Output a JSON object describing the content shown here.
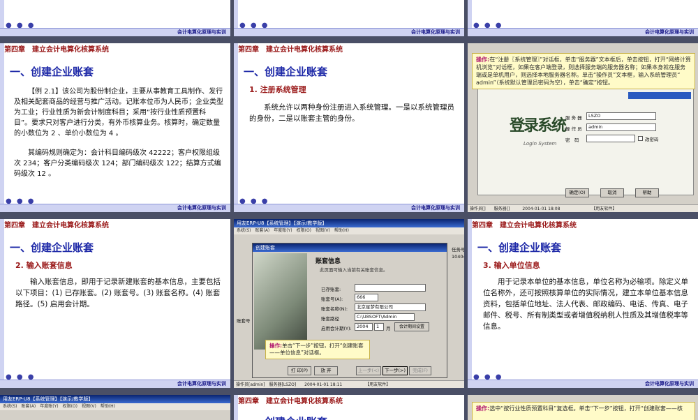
{
  "common": {
    "brand": "会计电算化原理与实训",
    "dots": "● ● ●",
    "chapter": "第四章　建立会计电算化核算系统"
  },
  "s4": {
    "title": "一、创建企业账套",
    "p1": "【例 2.1】该公司为股份制企业，主要从事教育工具制作、发行及相关配套商品的经营与推广活动。记账本位币为人民币；企业类型为工业；行业性质为新会计制度科目；采用“按行业性质预置科目”。要求只对客户进行分类，有外币核算业务。核算时，确定数量的小数位为 2 、单价小数位为 4 。",
    "p2": "其编码规则确定为：会计科目编码级次 42222；客户权限组级次 234；客户分类编码级次 124；部门编码级次 122；结算方式编码级次 12 。"
  },
  "s5": {
    "title": "一、创建企业账套",
    "subtitle": "1. 注册系统管理",
    "p1": "系统允许以两种身份注册进入系统管理。一是以系统管理员的身份，二是以账套主管的身份。"
  },
  "s6": {
    "note_key": "操作:",
    "note": "在“注册〖系统管理〗”对话框，单击“服务器”文本框后，单击按钮，打开“网络计算机浏览”对话框，如果在客户端登录，则选择服务端的服务器名称；如果本身就在服务端或是单机用户，则选择本地服务器名称。单击“操作员”文本框，输入系统管理员“ admin”（系统默认管理员密码为空），单击“确定”按钮。",
    "logo": "登录系统",
    "logo_sub": "Login System",
    "server_label": "服 务 器",
    "server_value": "LSZO",
    "operator_label": "操 作 员",
    "operator_value": "admin",
    "password_label": "密　码",
    "change_pwd": "改密码",
    "ok": "确定(O)",
    "cancel": "取消",
    "help": "帮助",
    "status": "操作员[]　　服务器[]　　　2004-01-01 18:08　　　　　　　　【用友软件】"
  },
  "s7": {
    "title": "一、创建企业账套",
    "subtitle": "2. 输入账套信息",
    "p1": "输入账套信息，即用于记录新建账套的基本信息，主要包括以下项目：(1) 已存账套。(2) 账套号。(3) 账套名称。(4) 账套路径。(5) 启用会计期。"
  },
  "s8": {
    "window_title": "用友ERP-U8【系统管理】【演示/教学版】",
    "menu": "系统(S)　账套(A)　年度账(Y)　权限(O)　视图(V)　帮助(H)",
    "dialog_title": "创建账套",
    "header": "账套信息",
    "header_sub": "此页面可输入当前有关账套信息。",
    "existing_label": "已存账套:",
    "acct_no_label": "账套号(A):",
    "acct_no": "666",
    "acct_name_label": "账套名称(N):",
    "acct_name": "北京星梦有限公司",
    "path_label": "账套路径",
    "path": "C:\\U8SOFT\\Admin",
    "period_label": "启用会计期(Y):",
    "year": "2004",
    "month": "1",
    "month_suffix": "月",
    "period_btn": "会计期间设置",
    "task_label": "任务号",
    "task_value": "104041",
    "side_label": "账套号",
    "note_key": "操作:",
    "note": "单击“下一步”按钮，打开“创建账套——单位信息”对话框。",
    "b_print": "打 印(P)",
    "b_cancel": "放 弃",
    "b_prev": "上一步(<)",
    "b_next": "下一步(>)",
    "b_finish": "完成(F)",
    "status": "操作员[admin]　服务器[LSZO]　　2004-01-01 18:11　　　　　　【用友软件】"
  },
  "s9": {
    "title": "一、创建企业账套",
    "subtitle": "3. 输入单位信息",
    "p1": "用于记录本单位的基本信息，单位名称为必输项。除定义单位名称外，还可按照核算单位的实际情况，建立本单位基本信息资料，包括单位地址、法人代表、邮政编码、电话、传真、电子邮件、税号、所有制类型或者增值税纳税人性质及其增值税率等信息。"
  },
  "s10": {
    "title": "用友ERP-U8【系统管理】【演示/教学版】",
    "menu": "系统(S)　账套(A)　年度账(Y)　权限(O)　视图(V)　帮助(H)"
  },
  "s11": {
    "title": "一、创建企业账套"
  },
  "s12": {
    "note_key": "操作:",
    "note": "选中“按行业性质预置科目”复选框。单击“下一步”按钮，打开“创建账套——核"
  }
}
